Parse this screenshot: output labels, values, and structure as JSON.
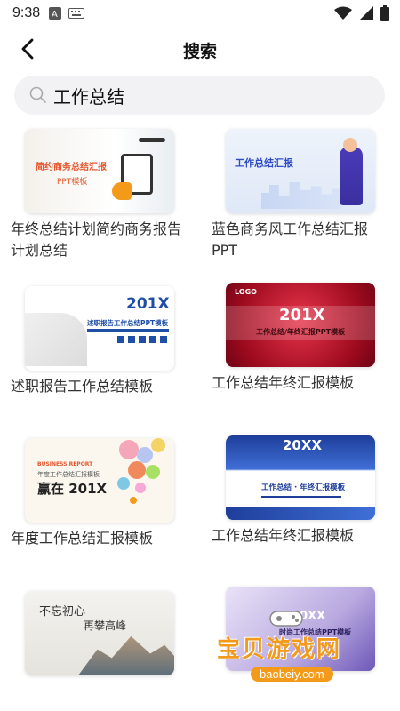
{
  "status": {
    "time": "9:38",
    "left_icons": [
      "app-a-icon",
      "keyboard-icon"
    ],
    "right_icons": [
      "wifi-icon",
      "signal-icon",
      "battery-icon"
    ]
  },
  "header": {
    "title": "搜索",
    "back_icon": "chevron-left-icon"
  },
  "search": {
    "value": "工作总结",
    "icon": "search-icon"
  },
  "results": [
    {
      "title": "年终总结计划简约商务报告计划总结",
      "thumb_text": [
        "简约商务总结汇报",
        "PPT模板"
      ]
    },
    {
      "title": "蓝色商务风工作总结汇报PPT",
      "thumb_text": [
        "工作总结汇报"
      ]
    },
    {
      "title": "述职报告工作总结模板",
      "thumb_text": [
        "201X",
        "述职报告工作总结PPT模板"
      ]
    },
    {
      "title": "工作总结年终汇报模板",
      "thumb_text": [
        "LOGO",
        "201X",
        "工作总结/年终汇报PPT模板"
      ]
    },
    {
      "title": "年度工作总结汇报模板",
      "thumb_text": [
        "BUSINESS REPORT",
        "年度工作总结汇报模板",
        "赢在 201X"
      ]
    },
    {
      "title": "工作总结年终汇报模板",
      "thumb_text": [
        "20XX",
        "工作总结 · 年终汇报模板"
      ]
    },
    {
      "title": "",
      "thumb_text": [
        "不忘初心",
        "再攀高峰"
      ]
    },
    {
      "title": "",
      "thumb_text": [
        "20XX",
        "时尚工作总结PPT模板"
      ]
    }
  ],
  "watermark": {
    "main": "宝贝游戏网",
    "sub": "baobeiy.com"
  },
  "colors": {
    "accent_orange": "#f39a1a",
    "search_bg": "#f2f2f4"
  }
}
